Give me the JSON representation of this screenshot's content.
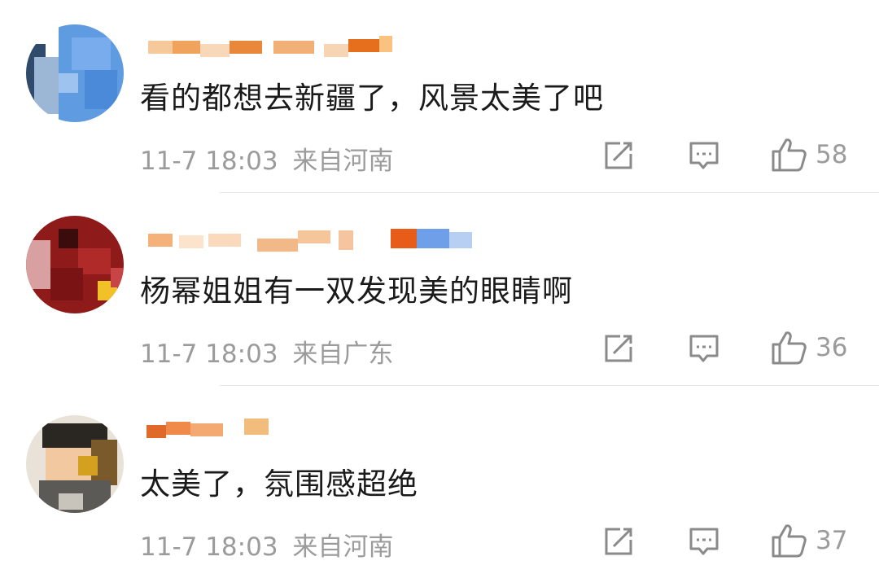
{
  "comments": [
    {
      "text": "看的都想去新疆了，风景太美了吧",
      "time": "11-7 18:03",
      "location": "来自河南",
      "likes": "58"
    },
    {
      "text": "杨幂姐姐有一双发现美的眼睛啊",
      "time": "11-7 18:03",
      "location": "来自广东",
      "likes": "36"
    },
    {
      "text": "太美了，氛围感超绝",
      "time": "11-7 18:03",
      "location": "来自河南",
      "likes": "37"
    }
  ],
  "icons": {
    "share": "share-icon",
    "reply": "comment-icon",
    "like": "thumbs-up-icon"
  },
  "colors": {
    "text": "#1a1a1a",
    "meta": "#9b9b9b",
    "divider": "#e6e6e6"
  }
}
